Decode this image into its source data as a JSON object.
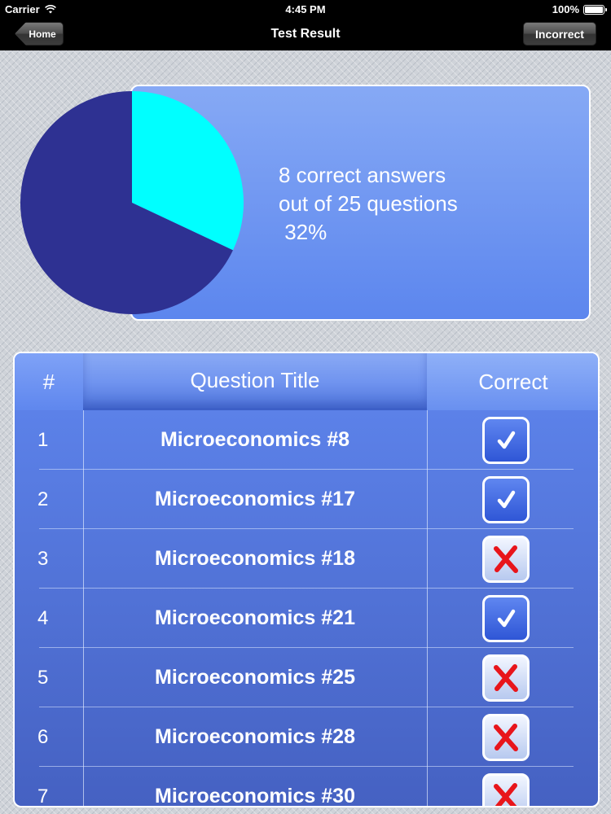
{
  "status_bar": {
    "carrier": "Carrier",
    "time": "4:45 PM",
    "battery": "100%",
    "icons": [
      "wifi-icon",
      "battery-icon"
    ]
  },
  "nav": {
    "title": "Test Result",
    "home_label": "Home",
    "incorrect_label": "Incorrect"
  },
  "summary": {
    "text": "8 correct answers\nout of 25 questions\n 32%",
    "correct": 8,
    "total": 25,
    "percent": 32
  },
  "chart_data": {
    "type": "pie",
    "slices": [
      {
        "label": "correct",
        "value": 8,
        "color": "#00ffff"
      },
      {
        "label": "incorrect",
        "value": 17,
        "color": "#2e3192"
      }
    ],
    "start": "12 o'clock",
    "direction": "clockwise"
  },
  "table": {
    "headers": {
      "num": "#",
      "title": "Question Title",
      "correct": "Correct"
    },
    "rows": [
      {
        "num": "1",
        "title": "Microeconomics #8",
        "correct": true
      },
      {
        "num": "2",
        "title": "Microeconomics #17",
        "correct": true
      },
      {
        "num": "3",
        "title": "Microeconomics #18",
        "correct": false
      },
      {
        "num": "4",
        "title": "Microeconomics #21",
        "correct": true
      },
      {
        "num": "5",
        "title": "Microeconomics #25",
        "correct": false
      },
      {
        "num": "6",
        "title": "Microeconomics #28",
        "correct": false
      },
      {
        "num": "7",
        "title": "Microeconomics #30",
        "correct": false
      }
    ]
  },
  "colors": {
    "nav_bg": "#000000",
    "panel_top": "#86a9f5",
    "panel_bottom": "#5c86ee",
    "check_blue": "#2f56d6",
    "x_red": "#e8151b"
  }
}
